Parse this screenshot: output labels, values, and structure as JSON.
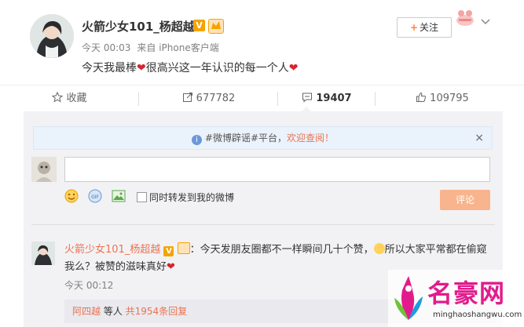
{
  "post": {
    "username": "火箭少女101_杨超越",
    "verified_badge": "V",
    "level_badge": "lv-badge",
    "time": "今天 00:03",
    "source": "来自 iPhone客户端",
    "content_part1": "今天我最棒",
    "content_part2": "很高兴这一年认识的每一个人",
    "follow_label": "关注",
    "follow_plus": "+",
    "heart_color": "#d8232f"
  },
  "actions": {
    "favorite": "收藏",
    "repost": "677782",
    "comment": "19407",
    "like": "109795"
  },
  "comments": {
    "notice_prefix": "#微博辟谣#平台，",
    "notice_link": "欢迎查阅！",
    "notice_close": "×",
    "repost_also_label": "同时转发到我的微博",
    "submit_label": "评论",
    "first_comment": {
      "username": "火箭少女101_杨超越",
      "text_part1": "：今天发朋友圈都不一样瞬间几十个赞，",
      "text_part2": "所以大家平常都在偷窥我么？被赞的滋味真好",
      "time": "今天 00:12",
      "reply_user": "阿四越",
      "reply_mid": " 等人 ",
      "reply_count": "共1954条回复"
    }
  },
  "watermark": {
    "title": "名豪网",
    "url": "minghaoshangwu.com"
  },
  "colors": {
    "accent": "#eb7350",
    "notice_bg": "#eaf2fb",
    "panel_bg": "#f2f2f5",
    "submit_bg": "#f8b48d"
  }
}
